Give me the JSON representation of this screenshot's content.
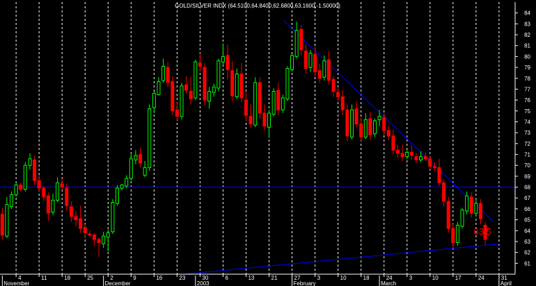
{
  "chart_data": {
    "type": "candlestick",
    "title": "GOLD/SILVER INDX (64.5100,64.8400,62.6800,63.1600,-1.50000)",
    "ylim": [
      60,
      85
    ],
    "yticks": [
      61,
      62,
      63,
      64,
      65,
      66,
      67,
      68,
      69,
      70,
      71,
      72,
      73,
      74,
      75,
      76,
      77,
      78,
      79,
      80,
      81,
      82,
      83,
      84
    ],
    "xticks": [
      {
        "label": "4",
        "x": 3
      },
      {
        "label": "11",
        "x": 8
      },
      {
        "label": "18",
        "x": 13
      },
      {
        "label": "25",
        "x": 18
      },
      {
        "label": "2",
        "x": 23
      },
      {
        "label": "9",
        "x": 28
      },
      {
        "label": "16",
        "x": 33
      },
      {
        "label": "23",
        "x": 38
      },
      {
        "label": "30",
        "x": 43
      },
      {
        "label": "6",
        "x": 48
      },
      {
        "label": "13",
        "x": 53
      },
      {
        "label": "21",
        "x": 58
      },
      {
        "label": "27",
        "x": 63
      },
      {
        "label": "3",
        "x": 68
      },
      {
        "label": "10",
        "x": 73
      },
      {
        "label": "18",
        "x": 78
      },
      {
        "label": "24",
        "x": 83
      },
      {
        "label": "3",
        "x": 88
      },
      {
        "label": "10",
        "x": 93
      },
      {
        "label": "17",
        "x": 98
      },
      {
        "label": "24",
        "x": 103
      },
      {
        "label": "31",
        "x": 108
      }
    ],
    "month_labels": [
      {
        "label": "November",
        "x": 0
      },
      {
        "label": "December",
        "x": 22
      },
      {
        "label": "2003",
        "x": 42
      },
      {
        "label": "February",
        "x": 63
      },
      {
        "label": "March",
        "x": 82
      },
      {
        "label": "April",
        "x": 108
      }
    ],
    "grid": "vertical dashed",
    "colors": {
      "up": "#00ff00",
      "down": "#ff0000",
      "trendline": "#0000ff",
      "annotation": "#ff0000"
    },
    "x_range": [
      -0.5,
      111.5
    ],
    "ohlc": [
      [
        65.5,
        66.1,
        63.1,
        63.6
      ],
      [
        63.5,
        67.1,
        63.3,
        66.4
      ],
      [
        66.2,
        67.6,
        66.0,
        67.3
      ],
      [
        67.3,
        68.4,
        67.1,
        68.2
      ],
      [
        68.2,
        68.4,
        67.6,
        67.8
      ],
      [
        67.8,
        70.3,
        67.6,
        70.0
      ],
      [
        70.0,
        71.1,
        69.6,
        70.6
      ],
      [
        70.5,
        70.9,
        68.2,
        68.6
      ],
      [
        68.6,
        69.1,
        67.6,
        67.9
      ],
      [
        67.9,
        68.1,
        66.7,
        67.1
      ],
      [
        67.2,
        67.5,
        64.9,
        65.6
      ],
      [
        65.7,
        67.4,
        65.4,
        66.8
      ],
      [
        66.8,
        68.9,
        66.6,
        68.4
      ],
      [
        68.3,
        68.8,
        67.8,
        68.0
      ],
      [
        67.9,
        68.3,
        65.8,
        66.3
      ],
      [
        66.2,
        66.7,
        64.8,
        65.3
      ],
      [
        65.3,
        65.8,
        64.4,
        65.0
      ],
      [
        65.1,
        66.3,
        63.8,
        64.2
      ],
      [
        64.3,
        64.6,
        63.3,
        63.8
      ],
      [
        63.7,
        64.0,
        63.4,
        63.6
      ],
      [
        63.6,
        63.8,
        62.6,
        63.2
      ],
      [
        63.2,
        63.4,
        61.6,
        62.9
      ],
      [
        62.8,
        63.9,
        62.4,
        63.5
      ],
      [
        63.4,
        64.1,
        62.1,
        63.8
      ],
      [
        63.9,
        66.9,
        63.7,
        66.6
      ],
      [
        66.5,
        68.2,
        66.3,
        67.9
      ],
      [
        67.9,
        68.3,
        67.7,
        68.2
      ],
      [
        68.1,
        69.1,
        67.9,
        68.8
      ],
      [
        68.8,
        71.1,
        68.6,
        70.6
      ],
      [
        70.5,
        71.4,
        70.1,
        70.9
      ],
      [
        71.0,
        71.6,
        69.8,
        70.2
      ],
      [
        69.1,
        70.4,
        68.9,
        69.8
      ],
      [
        69.8,
        75.6,
        69.5,
        75.2
      ],
      [
        75.3,
        76.8,
        74.8,
        76.6
      ],
      [
        76.5,
        78.1,
        76.4,
        77.7
      ],
      [
        77.8,
        79.8,
        77.6,
        79.1
      ],
      [
        79.0,
        79.5,
        77.2,
        77.6
      ],
      [
        77.7,
        78.2,
        74.6,
        75.0
      ],
      [
        75.1,
        75.9,
        74.1,
        74.5
      ],
      [
        74.5,
        77.6,
        74.2,
        77.3
      ],
      [
        77.4,
        78.2,
        76.6,
        76.9
      ],
      [
        76.8,
        78.1,
        75.6,
        76.1
      ],
      [
        76.2,
        79.7,
        76.0,
        79.5
      ],
      [
        79.4,
        80.3,
        78.6,
        79.1
      ],
      [
        79.0,
        79.4,
        75.5,
        76.0
      ],
      [
        75.9,
        77.2,
        75.2,
        76.8
      ],
      [
        76.7,
        77.5,
        76.3,
        77.2
      ],
      [
        77.1,
        79.8,
        76.8,
        79.6
      ],
      [
        79.5,
        81.2,
        79.2,
        80.0
      ],
      [
        80.1,
        81.1,
        77.9,
        78.8
      ],
      [
        78.7,
        79.6,
        75.9,
        76.4
      ],
      [
        76.3,
        78.9,
        76.1,
        78.4
      ],
      [
        78.4,
        79.4,
        75.8,
        76.2
      ],
      [
        76.0,
        76.8,
        74.1,
        74.6
      ],
      [
        74.5,
        75.6,
        73.4,
        73.8
      ],
      [
        73.7,
        78.1,
        73.5,
        77.6
      ],
      [
        77.6,
        78.1,
        74.3,
        74.8
      ],
      [
        74.8,
        75.6,
        73.2,
        73.6
      ],
      [
        73.5,
        75.1,
        72.6,
        74.8
      ],
      [
        74.7,
        77.1,
        74.5,
        76.8
      ],
      [
        76.9,
        77.6,
        74.6,
        75.1
      ],
      [
        75.1,
        76.5,
        74.8,
        76.2
      ],
      [
        76.1,
        79.1,
        75.9,
        78.9
      ],
      [
        78.8,
        80.2,
        78.6,
        80.1
      ],
      [
        80.0,
        83.2,
        79.8,
        82.4
      ],
      [
        82.5,
        82.9,
        80.1,
        80.6
      ],
      [
        80.5,
        81.1,
        78.4,
        78.9
      ],
      [
        79.0,
        80.6,
        78.6,
        80.3
      ],
      [
        80.2,
        80.9,
        78.1,
        78.6
      ],
      [
        78.7,
        79.3,
        77.6,
        78.0
      ],
      [
        78.1,
        80.1,
        77.8,
        79.6
      ],
      [
        79.7,
        80.5,
        77.4,
        77.8
      ],
      [
        77.9,
        78.2,
        76.3,
        76.8
      ],
      [
        76.7,
        77.2,
        75.9,
        76.3
      ],
      [
        76.3,
        76.9,
        74.6,
        75.1
      ],
      [
        75.1,
        75.6,
        72.2,
        72.7
      ],
      [
        72.6,
        75.6,
        72.4,
        75.1
      ],
      [
        75.2,
        75.9,
        73.5,
        73.8
      ],
      [
        73.8,
        74.4,
        72.2,
        72.6
      ],
      [
        72.6,
        74.8,
        72.4,
        74.2
      ],
      [
        74.3,
        74.9,
        72.3,
        72.8
      ],
      [
        72.9,
        74.3,
        72.6,
        74.1
      ],
      [
        74.2,
        75.1,
        73.6,
        74.5
      ],
      [
        74.4,
        74.8,
        72.8,
        73.2
      ],
      [
        73.2,
        73.6,
        72.3,
        72.7
      ],
      [
        72.7,
        73.3,
        71.0,
        71.4
      ],
      [
        71.4,
        71.9,
        70.7,
        71.1
      ],
      [
        71.1,
        71.9,
        70.4,
        70.8
      ],
      [
        70.8,
        71.4,
        70.6,
        71.2
      ],
      [
        71.2,
        71.8,
        70.5,
        70.9
      ],
      [
        70.8,
        71.1,
        70.2,
        70.5
      ],
      [
        70.5,
        71.3,
        70.3,
        70.8
      ],
      [
        70.8,
        71.2,
        70.4,
        70.6
      ],
      [
        70.6,
        70.9,
        69.6,
        69.9
      ],
      [
        69.9,
        70.3,
        69.5,
        69.8
      ],
      [
        69.8,
        70.6,
        68.1,
        68.4
      ],
      [
        68.4,
        68.7,
        66.2,
        66.7
      ],
      [
        66.7,
        67.1,
        63.8,
        64.2
      ],
      [
        64.2,
        64.7,
        62.4,
        62.9
      ],
      [
        62.9,
        64.8,
        62.6,
        64.5
      ],
      [
        64.4,
        66.1,
        64.2,
        65.9
      ],
      [
        65.8,
        67.6,
        65.5,
        67.2
      ],
      [
        67.1,
        67.5,
        65.2,
        65.6
      ],
      [
        65.6,
        66.9,
        65.3,
        66.5
      ],
      [
        66.5,
        66.9,
        64.6,
        65.1
      ],
      [
        64.5,
        64.8,
        62.7,
        63.2
      ]
    ],
    "lines": [
      {
        "name": "horizontal-line",
        "points": [
          [
            -0.5,
            68.0
          ],
          [
            111.5,
            68.0
          ]
        ]
      },
      {
        "name": "descending-trendline",
        "points": [
          [
            61.2,
            83.3
          ],
          [
            106.8,
            64.8
          ]
        ]
      },
      {
        "name": "ascending-trendline",
        "points": [
          [
            39.5,
            60.0
          ],
          [
            108.3,
            62.8
          ]
        ]
      }
    ],
    "annotation": {
      "text": "63.5",
      "x": 102.5,
      "y": 63.9
    }
  }
}
